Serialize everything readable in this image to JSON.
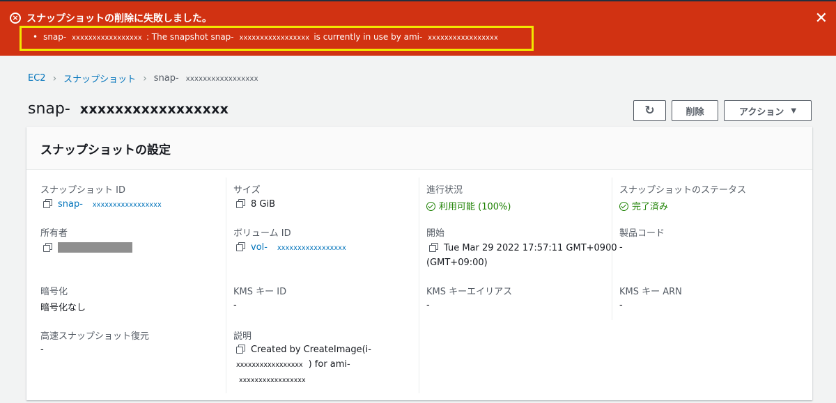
{
  "error_banner": {
    "title": "スナップショットの削除に失敗しました。",
    "bullet": "•",
    "snap_prefix": "snap-",
    "snap_id": "xxxxxxxxxxxxxxxxx",
    "msg_middle": ": The snapshot snap-",
    "snap_id_2": "xxxxxxxxxxxxxxxxx",
    "msg_end": "is currently in use by ami-",
    "ami_id": "xxxxxxxxxxxxxxxxx",
    "close_symbol": "✕"
  },
  "breadcrumb": {
    "items": [
      "EC2",
      "スナップショット"
    ],
    "current_prefix": "snap-",
    "current_id": "xxxxxxxxxxxxxxxxx",
    "separator": "›"
  },
  "page": {
    "title_prefix": "snap-",
    "title_id": "xxxxxxxxxxxxxxxxx"
  },
  "toolbar": {
    "refresh_symbol": "↻",
    "delete_label": "削除",
    "actions_label": "アクション",
    "actions_caret": "▼"
  },
  "panel": {
    "title": "スナップショットの設定",
    "snapshot_id": {
      "label": "スナップショット ID",
      "prefix": "snap-",
      "value": "xxxxxxxxxxxxxxxxx"
    },
    "size": {
      "label": "サイズ",
      "value": "8 GiB"
    },
    "progress": {
      "label": "進行状況",
      "value": "利用可能 (100%)"
    },
    "snapshot_status": {
      "label": "スナップショットのステータス",
      "value": "完了済み"
    },
    "owner": {
      "label": "所有者"
    },
    "volume_id": {
      "label": "ボリューム ID",
      "prefix": "vol-",
      "value": "xxxxxxxxxxxxxxxxx"
    },
    "started": {
      "label": "開始",
      "line1": "Tue Mar 29 2022 17:57:11 GMT+0900",
      "line2": "(GMT+09:00)"
    },
    "product_code": {
      "label": "製品コード",
      "value": "-"
    },
    "encryption": {
      "label": "暗号化",
      "value": "暗号化なし"
    },
    "kms_key_id": {
      "label": "KMS キー ID",
      "value": "-"
    },
    "kms_key_alias": {
      "label": "KMS キーエイリアス",
      "value": "-"
    },
    "kms_key_arn": {
      "label": "KMS キー ARN",
      "value": "-"
    },
    "fast_restore": {
      "label": "高速スナップショット復元",
      "value": "-"
    },
    "description": {
      "label": "説明",
      "line1": "Created by CreateImage(i-",
      "line2_id": "xxxxxxxxxxxxxxxxx",
      "line2_end": ") for ami-",
      "line3_id": "xxxxxxxxxxxxxxxxx"
    }
  },
  "colors": {
    "error_red": "#d13212",
    "highlight_yellow": "#f2e700",
    "link_blue": "#0073bb",
    "success_green": "#1d8102"
  }
}
